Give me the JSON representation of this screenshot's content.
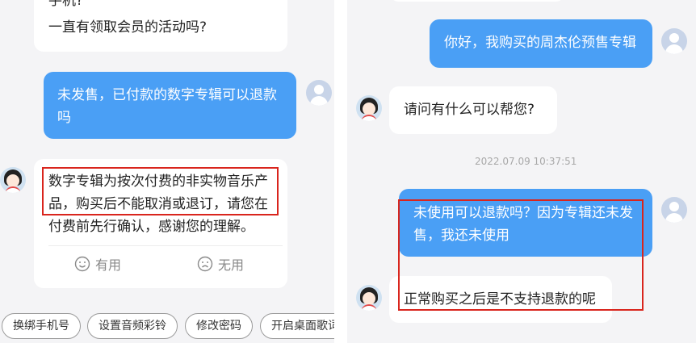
{
  "left": {
    "top_partial_text": "手机?",
    "top_question": "一直有领取会员的活动吗?",
    "user_message": "未发售，已付款的数字专辑可以退款吗",
    "agent_reply": "数字专辑为按次付费的非实物音乐产品，购买后不能取消或退订，请您在付费前先行确认，感谢您的理解。",
    "feedback": {
      "useful": "有用",
      "useless": "无用"
    },
    "quick_actions": [
      "换绑手机号",
      "设置音频彩铃",
      "修改密码",
      "开启桌面歌词"
    ]
  },
  "right": {
    "user_message_1": "你好，我购买的周杰伦预售专辑",
    "agent_message_1": "请问有什么可以帮您?",
    "timestamp": "2022.07.09 10:37:51",
    "user_message_2": "未使用可以退款吗？因为专辑还未发售，我还未使用",
    "agent_message_2": "正常购买之后是不支持退款的呢"
  },
  "colors": {
    "user_bubble": "#4a9ff5",
    "agent_bubble": "#ffffff",
    "highlight_box": "#d9251d",
    "background": "#f4f4f6"
  }
}
